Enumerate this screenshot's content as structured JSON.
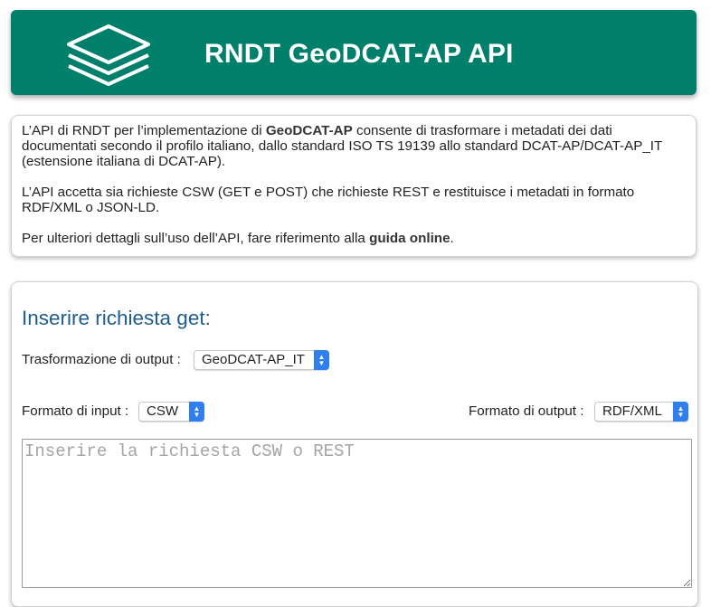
{
  "header": {
    "title": "RNDT GeoDCAT-AP API",
    "logo_icon": "layers-icon",
    "background": "#007f6b"
  },
  "intro": {
    "p1_a": "L’API di RNDT per l’implementazione di ",
    "p1_b": "GeoDCAT-AP",
    "p1_c": " consente di trasformare i metadati dei dati documentati secondo il profilo italiano, dallo standard ISO TS 19139 allo standard DCAT-AP/DCAT-AP_IT (estensione italiana di DCAT-AP).",
    "p2": "L’API accetta sia richieste CSW (GET e POST) che richieste REST e restituisce i metadati in formato RDF/XML o JSON-LD.",
    "p3_a": "Per ulteriori dettagli sull’uso dell’API, fare riferimento alla ",
    "p3_link": "guida online",
    "p3_c": "."
  },
  "form": {
    "title": "Inserire richiesta get:",
    "transform_label": "Trasformazione di output :",
    "transform_value": "GeoDCAT-AP_IT",
    "input_format_label": "Formato di input :",
    "input_format_value": "CSW",
    "output_format_label": "Formato di output :",
    "output_format_value": "RDF/XML",
    "request_placeholder": "Inserire la richiesta CSW o REST",
    "title_color": "#1f5c8e",
    "select_arrow_color": "#2f7fef"
  }
}
